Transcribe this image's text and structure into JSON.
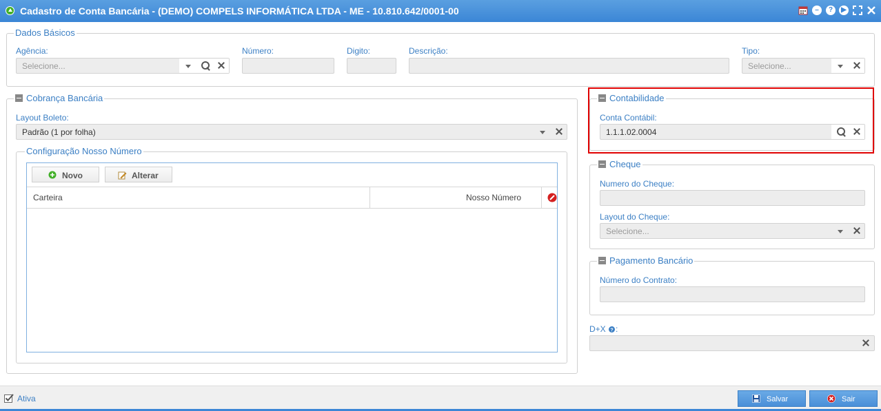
{
  "window": {
    "title": "Cadastro de Conta Bancária - (DEMO) COMPELS INFORMÁTICA LTDA - ME - 10.810.642/0001-00",
    "toolbar_icons": [
      "calendar-icon",
      "minimize-icon",
      "help-icon",
      "play-icon",
      "fullscreen-icon",
      "close-icon"
    ]
  },
  "dados_basicos": {
    "legend": "Dados Básicos",
    "agencia_label": "Agência:",
    "agencia_placeholder": "Selecione...",
    "numero_label": "Número:",
    "digito_label": "Digito:",
    "descricao_label": "Descrição:",
    "tipo_label": "Tipo:",
    "tipo_placeholder": "Selecione..."
  },
  "cobranca": {
    "legend": "Cobrança Bancária",
    "layout_label": "Layout Boleto:",
    "layout_value": "Padrão (1 por folha)",
    "config_legend": "Configuração Nosso Número",
    "novo_label": "Novo",
    "alterar_label": "Alterar",
    "columns": [
      "Carteira",
      "Nosso Número"
    ]
  },
  "contabilidade": {
    "legend": "Contabilidade",
    "conta_label": "Conta Contábil:",
    "conta_value": "1.1.1.02.0004"
  },
  "cheque": {
    "legend": "Cheque",
    "numero_label": "Numero do Cheque:",
    "layout_label": "Layout do Cheque:",
    "layout_placeholder": "Selecione..."
  },
  "pagamento": {
    "legend": "Pagamento Bancário",
    "contrato_label": "Número do Contrato:"
  },
  "dx": {
    "label": "D+X",
    "suffix": ":"
  },
  "footer": {
    "ativa_label": "Ativa",
    "salvar_label": "Salvar",
    "sair_label": "Sair"
  },
  "colors": {
    "accent": "#3b86d6",
    "label": "#3b7fc4",
    "highlight": "#e00000"
  }
}
